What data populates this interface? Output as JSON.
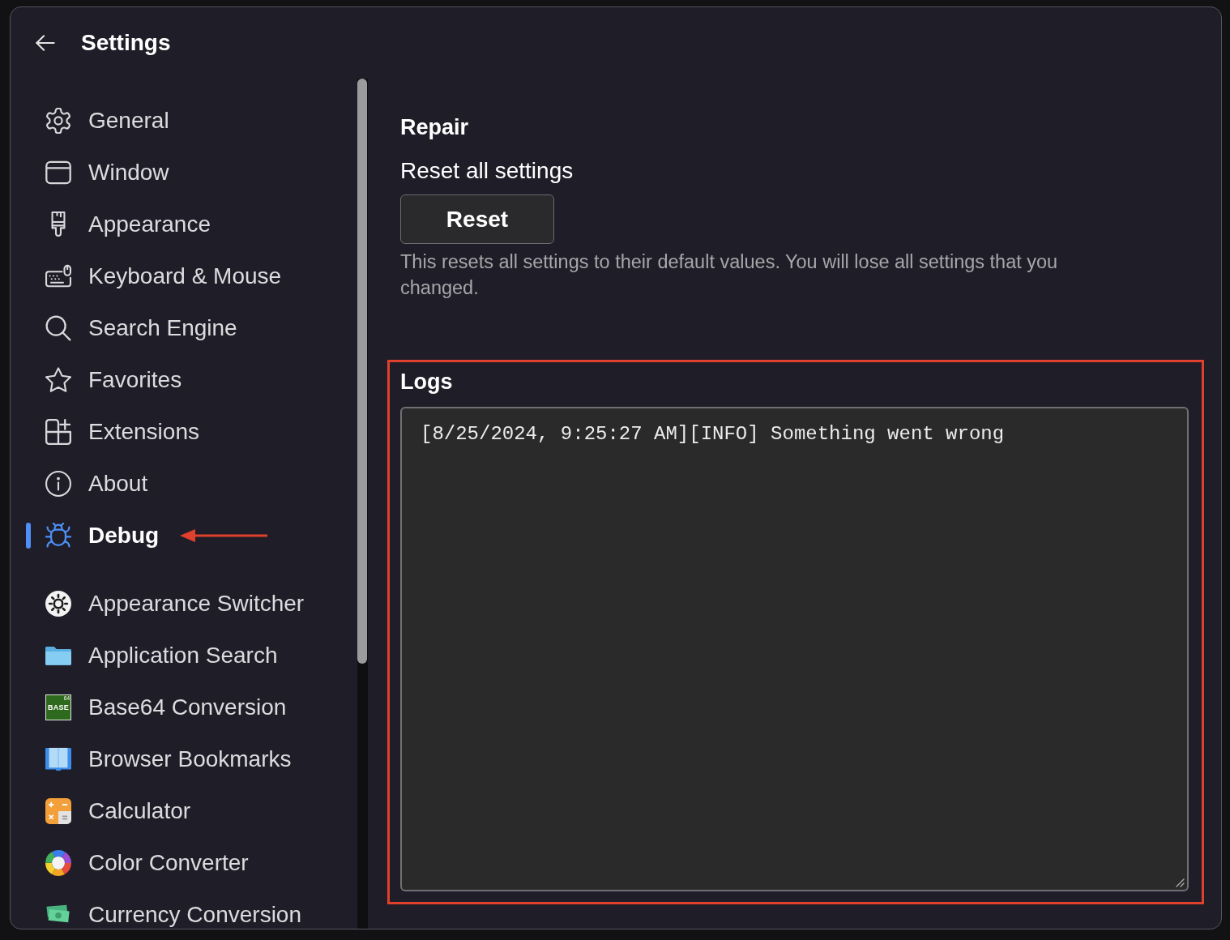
{
  "header": {
    "title": "Settings"
  },
  "sidebar": {
    "groups": [
      {
        "items": [
          {
            "label": "General",
            "selected": false,
            "annotated": false
          },
          {
            "label": "Window",
            "selected": false,
            "annotated": false
          },
          {
            "label": "Appearance",
            "selected": false,
            "annotated": false
          },
          {
            "label": "Keyboard & Mouse",
            "selected": false,
            "annotated": false
          },
          {
            "label": "Search Engine",
            "selected": false,
            "annotated": false
          },
          {
            "label": "Favorites",
            "selected": false,
            "annotated": false
          },
          {
            "label": "Extensions",
            "selected": false,
            "annotated": false
          },
          {
            "label": "About",
            "selected": false,
            "annotated": false
          },
          {
            "label": "Debug",
            "selected": true,
            "annotated": true
          }
        ]
      },
      {
        "items": [
          {
            "label": "Appearance Switcher",
            "selected": false,
            "annotated": false
          },
          {
            "label": "Application Search",
            "selected": false,
            "annotated": false
          },
          {
            "label": "Base64 Conversion",
            "selected": false,
            "annotated": false,
            "icon_label": {
              "main": "BASE",
              "corner": "64"
            }
          },
          {
            "label": "Browser Bookmarks",
            "selected": false,
            "annotated": false
          },
          {
            "label": "Calculator",
            "selected": false,
            "annotated": false
          },
          {
            "label": "Color Converter",
            "selected": false,
            "annotated": false
          },
          {
            "label": "Currency Conversion",
            "selected": false,
            "annotated": false
          }
        ]
      }
    ]
  },
  "repair": {
    "heading": "Repair",
    "setting_label": "Reset all settings",
    "button": "Reset",
    "description": "This resets all settings to their default values. You will lose all settings that you changed."
  },
  "logs": {
    "heading": "Logs",
    "highlighted": true,
    "entries": [
      "[8/25/2024, 9:25:27 AM][INFO] Something went wrong"
    ]
  }
}
